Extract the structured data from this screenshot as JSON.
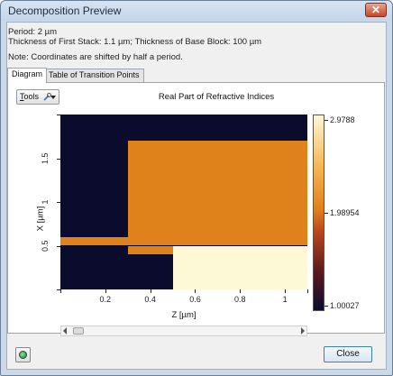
{
  "window": {
    "title": "Decomposition Preview"
  },
  "info": {
    "period": "Period: 2 µm",
    "thickness": "Thickness of First Stack: 1.1 µm; Thickness of Base Block: 100 µm",
    "note": "Note: Coordinates are shifted by half a period."
  },
  "tabs": [
    {
      "label": "Diagram",
      "active": true
    },
    {
      "label": "Table of Transition Points",
      "active": false
    }
  ],
  "toolbar": {
    "tools_prefix": "T",
    "tools_rest": "ools"
  },
  "colors": {
    "low": "#0b0b2e",
    "mid": "#e0821c",
    "high": "#fdf8d6"
  },
  "chart_data": {
    "type": "heatmap",
    "title": "Real Part of Refractive Indices",
    "xlabel": "Z [µm]",
    "ylabel": "X [µm]",
    "xlim": [
      0,
      1.1
    ],
    "ylim": [
      0,
      2
    ],
    "x_ticks": [
      "0.2",
      "0.4",
      "0.6",
      "0.8",
      "1"
    ],
    "y_ticks": [
      "0.5",
      "1",
      "1.5"
    ],
    "colorbar": {
      "min": "1.00027",
      "mid": "1.98954",
      "max": "2.9788"
    },
    "regions": [
      {
        "z": [
          0,
          1.1
        ],
        "x": [
          0,
          2
        ],
        "value": 1.00027
      },
      {
        "z": [
          0.3,
          1.1
        ],
        "x": [
          0.5,
          1.7
        ],
        "value": 1.98954
      },
      {
        "z": [
          0,
          0.3
        ],
        "x": [
          0.5,
          0.6
        ],
        "value": 1.98954
      },
      {
        "z": [
          0.3,
          0.5
        ],
        "x": [
          0.4,
          0.5
        ],
        "value": 1.98954
      },
      {
        "z": [
          0.5,
          1.1
        ],
        "x": [
          0,
          0.5
        ],
        "value": 2.9788
      }
    ]
  },
  "footer": {
    "close_label": "Close"
  }
}
